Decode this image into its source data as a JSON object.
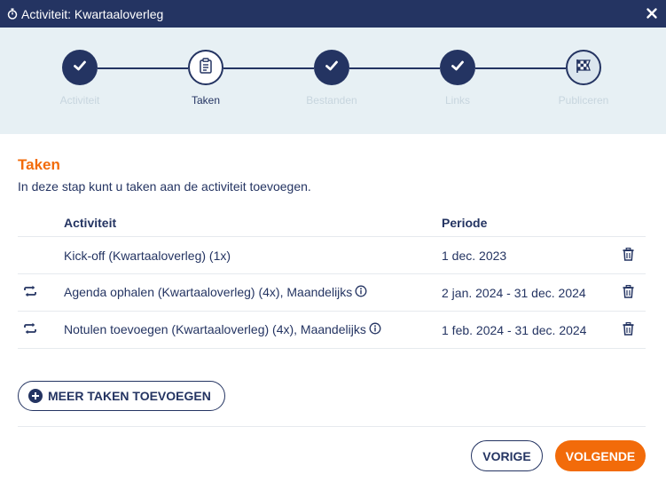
{
  "window": {
    "title": "Activiteit: Kwartaaloverleg"
  },
  "colors": {
    "navy": "#243462",
    "accent": "#f26b0a",
    "stepper_bg": "#e7f0f4",
    "muted": "#c7d5de"
  },
  "steps": [
    {
      "label": "Activiteit",
      "state": "done",
      "icon": "check-icon"
    },
    {
      "label": "Taken",
      "state": "current",
      "icon": "clipboard-icon"
    },
    {
      "label": "Bestanden",
      "state": "done",
      "icon": "check-icon"
    },
    {
      "label": "Links",
      "state": "done",
      "icon": "check-icon"
    },
    {
      "label": "Publiceren",
      "state": "todo",
      "icon": "checkered-flag-icon"
    }
  ],
  "section": {
    "title": "Taken",
    "description": "In deze stap kunt u taken aan de activiteit toevoegen."
  },
  "table": {
    "headers": {
      "activity": "Activiteit",
      "period": "Periode"
    },
    "rows": [
      {
        "recurring": false,
        "activity": "Kick-off (Kwartaaloverleg) (1x)",
        "info": false,
        "period": "1 dec. 2023"
      },
      {
        "recurring": true,
        "activity": "Agenda ophalen (Kwartaaloverleg) (4x), Maandelijks",
        "info": true,
        "period": "2 jan. 2024 - 31 dec. 2024"
      },
      {
        "recurring": true,
        "activity": "Notulen toevoegen (Kwartaaloverleg) (4x), Maandelijks",
        "info": true,
        "period": "1 feb. 2024 - 31 dec. 2024"
      }
    ]
  },
  "actions": {
    "add_more": "MEER TAKEN TOEVOEGEN",
    "previous": "VORIGE",
    "next": "VOLGENDE"
  }
}
